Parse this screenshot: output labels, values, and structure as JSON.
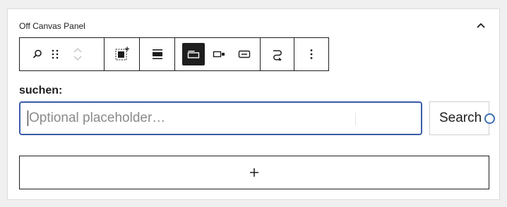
{
  "panel": {
    "title": "Off Canvas Panel",
    "collapse_icon": "chevron-up-icon"
  },
  "toolbar": {
    "groups": [
      {
        "items": [
          "search-block-icon",
          "drag-handle-icon",
          "move-up-icon",
          "move-down-icon"
        ]
      },
      {
        "items": [
          "block-add-icon"
        ]
      },
      {
        "items": [
          "justify-icon"
        ]
      },
      {
        "items": [
          "button-outside-icon",
          "button-inside-icon",
          "button-only-icon"
        ],
        "active": "button-outside-icon"
      },
      {
        "items": [
          "transform-icon"
        ]
      },
      {
        "items": [
          "more-options-icon"
        ]
      }
    ]
  },
  "search": {
    "label": "suchen:",
    "placeholder": "Optional placeholder…",
    "button_label": "Search"
  },
  "appender": {
    "icon": "plus-icon"
  },
  "colors": {
    "focus_border": "#3b5ba9",
    "dark": "#1e1e1e",
    "handle": "#3b6fb6"
  }
}
